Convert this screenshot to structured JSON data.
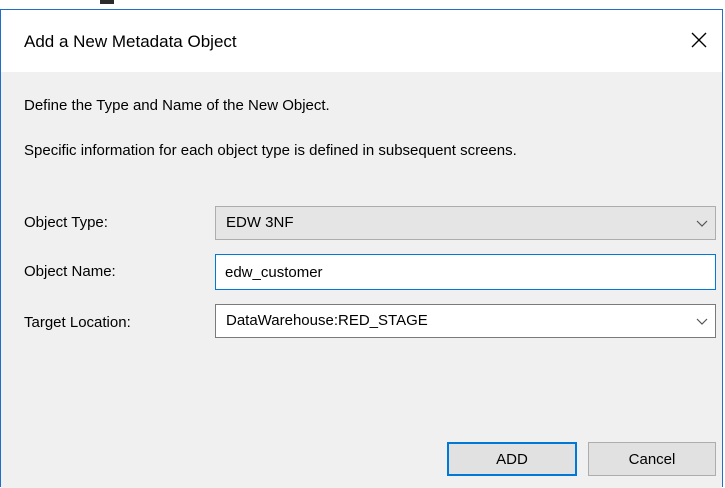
{
  "dialog": {
    "title": "Add a New Metadata Object",
    "close_glyph": "✕"
  },
  "description": {
    "line1": "Define the Type and Name of the New Object.",
    "line2": "Specific information for each object type is defined in subsequent screens."
  },
  "form": {
    "object_type": {
      "label": "Object Type:",
      "value": "EDW 3NF"
    },
    "object_name": {
      "label": "Object Name:",
      "value": "edw_customer"
    },
    "target_location": {
      "label": "Target Location:",
      "value": "DataWarehouse:RED_STAGE"
    }
  },
  "buttons": {
    "add_label": "ADD",
    "cancel_label": "Cancel"
  },
  "icons": {
    "close": "close-icon",
    "dropdown": "chevron-down-icon"
  },
  "colors": {
    "window_border": "#1e6fc7",
    "focus": "#0078d7",
    "client_bg": "#f0f0f0"
  }
}
